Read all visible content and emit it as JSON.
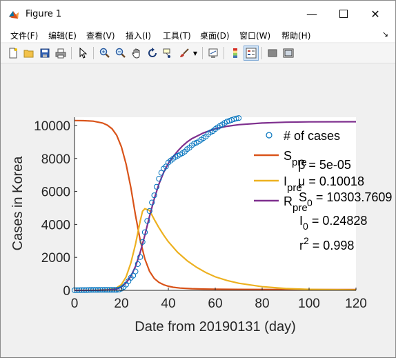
{
  "window": {
    "title": "Figure 1"
  },
  "menu": {
    "items": [
      "文件(F)",
      "编辑(E)",
      "查看(V)",
      "插入(I)",
      "工具(T)",
      "桌面(D)",
      "窗口(W)",
      "帮助(H)"
    ]
  },
  "toolbar": {
    "buttons": [
      "new-figure-icon",
      "open-file-icon",
      "save-icon",
      "print-icon",
      "pointer-icon",
      "zoom-in-icon",
      "zoom-out-icon",
      "pan-hand-icon",
      "rotate-3d-icon",
      "data-cursor-icon",
      "brush-icon",
      "link-plot-icon",
      "colorbar-icon",
      "legend-icon",
      "hide-plot-tools-icon",
      "show-plot-tools-icon"
    ]
  },
  "chart_data": {
    "type": "line",
    "xlabel": "Date from 20190131 (day)",
    "ylabel": "Cases in Korea",
    "xlim": [
      0,
      120
    ],
    "ylim": [
      0,
      10500
    ],
    "xticks": [
      0,
      20,
      40,
      60,
      80,
      100,
      120
    ],
    "yticks": [
      0,
      2000,
      4000,
      6000,
      8000,
      10000
    ],
    "xtick_labels": [
      "0",
      "20",
      "40",
      "60",
      "80",
      "100",
      "120"
    ],
    "ytick_labels": [
      "0",
      "2000",
      "4000",
      "6000",
      "8000",
      "10000"
    ],
    "legend": {
      "position": "top-right",
      "items": [
        {
          "label": "# of cases",
          "sub": "",
          "marker": "circle",
          "color": "#0072bd"
        },
        {
          "label": "S",
          "sub": "pre",
          "marker": "line",
          "color": "#d95319"
        },
        {
          "label": "I",
          "sub": "pre",
          "marker": "line",
          "color": "#edb120"
        },
        {
          "label": "R",
          "sub": "pre",
          "marker": "line",
          "color": "#7e2f8e"
        }
      ]
    },
    "annotations": [
      {
        "symbol": "β",
        "sub": "",
        "sup": "",
        "text": " = 5e-05"
      },
      {
        "symbol": "μ",
        "sub": "",
        "sup": "",
        "text": " = 0.10018"
      },
      {
        "symbol": "S",
        "sub": "0",
        "sup": "",
        "text": " = 10303.7609"
      },
      {
        "symbol": "I",
        "sub": "0",
        "sup": "",
        "text": " = 0.24828"
      },
      {
        "symbol": "r",
        "sub": "",
        "sup": "2",
        "text": " = 0.998"
      }
    ],
    "series": [
      {
        "name": "# of cases",
        "style": "circles",
        "color": "#0072bd",
        "x": [
          0,
          1,
          2,
          3,
          4,
          5,
          6,
          7,
          8,
          9,
          10,
          11,
          12,
          13,
          14,
          15,
          16,
          17,
          18,
          19,
          20,
          21,
          22,
          23,
          24,
          25,
          26,
          27,
          28,
          29,
          30,
          31,
          32,
          33,
          34,
          35,
          36,
          37,
          38,
          39,
          40,
          41,
          42,
          43,
          44,
          45,
          46,
          47,
          48,
          49,
          50,
          51,
          52,
          53,
          54,
          55,
          56,
          57,
          58,
          59,
          60,
          61,
          62,
          63,
          64,
          65,
          66,
          67,
          68,
          69,
          70
        ],
        "y": [
          4,
          11,
          12,
          15,
          16,
          18,
          23,
          24,
          24,
          25,
          27,
          28,
          28,
          28,
          28,
          28,
          29,
          30,
          31,
          51,
          104,
          204,
          346,
          556,
          763,
          893,
          1146,
          1595,
          2022,
          2931,
          3526,
          4212,
          4812,
          5328,
          5766,
          6284,
          6767,
          7134,
          7382,
          7513,
          7755,
          7869,
          7979,
          8086,
          8162,
          8236,
          8320,
          8413,
          8565,
          8652,
          8799,
          8897,
          8961,
          9037,
          9137,
          9241,
          9332,
          9478,
          9583,
          9661,
          9786,
          9887,
          9976,
          10062,
          10156,
          10237,
          10284,
          10331,
          10384,
          10423,
          10450
        ]
      },
      {
        "name": "S",
        "style": "line",
        "color": "#d95319",
        "x": [
          0,
          4,
          8,
          12,
          14,
          16,
          18,
          20,
          22,
          24,
          26,
          28,
          30,
          32,
          34,
          36,
          38,
          40,
          42,
          45,
          50,
          55,
          60,
          70,
          80,
          100,
          120
        ],
        "y": [
          10300,
          10290,
          10260,
          10150,
          10020,
          9800,
          9400,
          8700,
          7650,
          6250,
          4550,
          3050,
          1900,
          1150,
          720,
          480,
          340,
          250,
          190,
          140,
          100,
          80,
          70,
          60,
          55,
          52,
          50
        ]
      },
      {
        "name": "I",
        "style": "line",
        "color": "#edb120",
        "x": [
          0,
          8,
          14,
          16,
          18,
          20,
          22,
          24,
          26,
          28,
          29,
          30,
          32,
          34,
          36,
          38,
          40,
          44,
          48,
          52,
          56,
          60,
          65,
          70,
          80,
          90,
          100,
          120
        ],
        "y": [
          0,
          10,
          40,
          80,
          160,
          350,
          820,
          1650,
          2800,
          4200,
          4800,
          4950,
          4850,
          4300,
          3800,
          3350,
          2950,
          2300,
          1800,
          1400,
          1080,
          820,
          600,
          430,
          220,
          110,
          60,
          20
        ]
      },
      {
        "name": "R",
        "style": "line",
        "color": "#7e2f8e",
        "x": [
          0,
          10,
          14,
          16,
          18,
          20,
          22,
          24,
          26,
          28,
          30,
          32,
          34,
          36,
          38,
          40,
          42,
          44,
          46,
          48,
          50,
          55,
          60,
          65,
          70,
          80,
          90,
          100,
          120
        ],
        "y": [
          0,
          5,
          20,
          40,
          80,
          200,
          450,
          850,
          1450,
          2300,
          3350,
          4500,
          5550,
          6450,
          7150,
          7700,
          8100,
          8450,
          8750,
          9000,
          9200,
          9550,
          9800,
          9950,
          10050,
          10150,
          10200,
          10220,
          10230
        ]
      }
    ]
  }
}
